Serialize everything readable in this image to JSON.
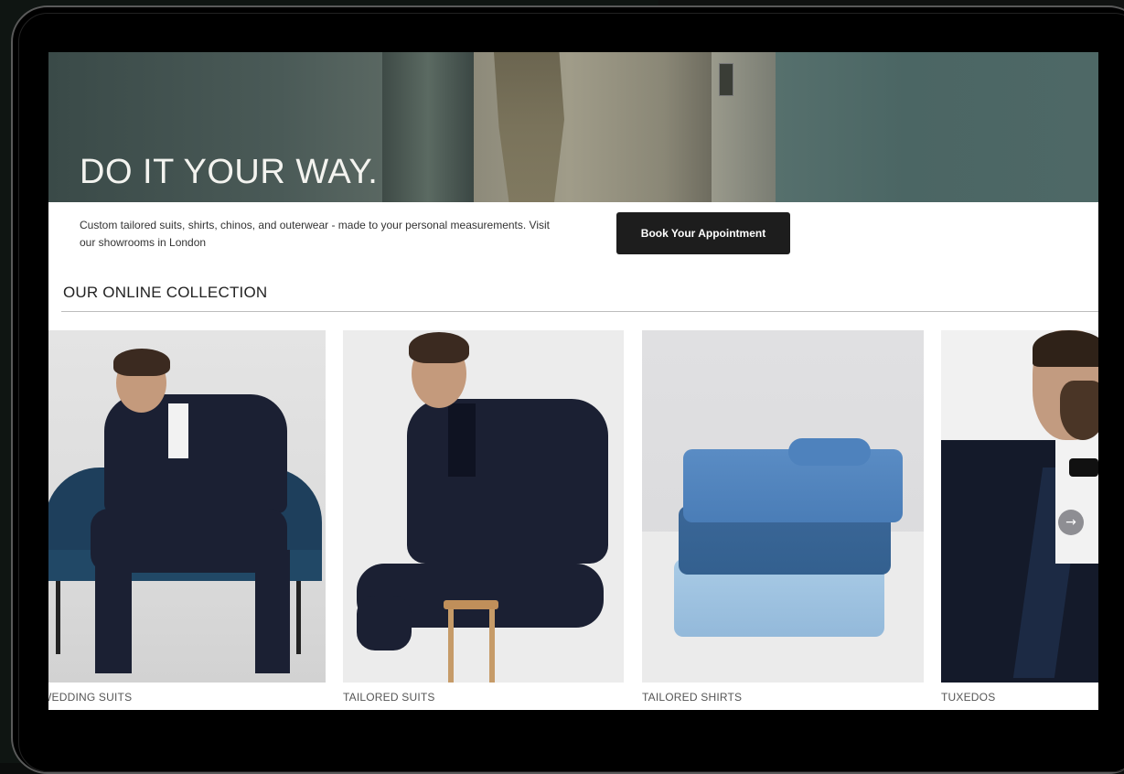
{
  "hero": {
    "title": "DO IT YOUR WAY."
  },
  "intro": {
    "text": "Custom tailored suits, shirts, chinos, and outerwear - made to your personal measurements. Visit our showrooms in London"
  },
  "cta": {
    "book_label": "Book Your Appointment"
  },
  "collection": {
    "title": "OUR ONLINE COLLECTION",
    "items": [
      {
        "label": "WEDDING SUITS"
      },
      {
        "label": "TAILORED SUITS"
      },
      {
        "label": "TAILORED SHIRTS"
      },
      {
        "label": "TUXEDOS"
      }
    ],
    "next_icon": "arrow-right-icon",
    "next_glyph": "→"
  },
  "colors": {
    "button_bg": "#1d1d1d",
    "hero_tone": "#4b6664"
  }
}
